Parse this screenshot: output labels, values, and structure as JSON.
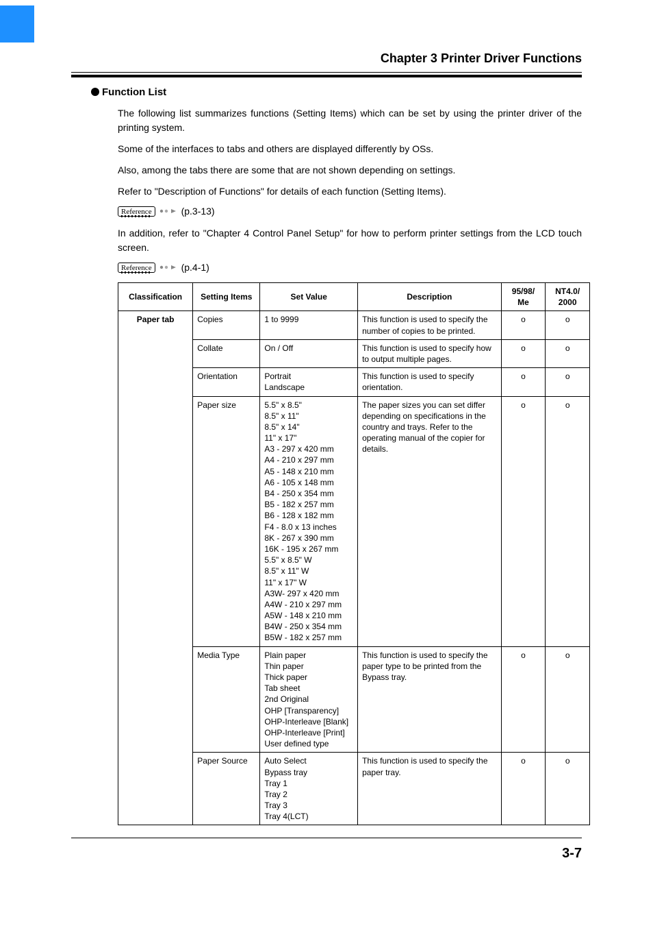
{
  "chapter_title": "Chapter 3 Printer Driver Functions",
  "section_heading": "Function List",
  "paragraphs": {
    "p1": "The following list summarizes functions (Setting Items) which can be set by using the printer driver of the printing system.",
    "p2": "Some of the interfaces to tabs and others are displayed differently by OSs.",
    "p3": "Also, among the tabs there are some that are not shown depending on settings.",
    "p4": "Refer to \"Description of Functions\" for details of each function (Setting Items).",
    "p5": "In addition, refer to \"Chapter 4 Control Panel Setup\" for how to perform printer settings from the LCD touch screen."
  },
  "references": {
    "label": "Reference",
    "r1": "(p.3-13)",
    "r2": "(p.4-1)"
  },
  "table": {
    "headers": {
      "classification": "Classification",
      "setting_items": "Setting Items",
      "set_value": "Set Value",
      "description": "Description",
      "os1": "95/98/\nMe",
      "os2": "NT4.0/\n2000"
    },
    "classification_value": "Paper tab",
    "rows": [
      {
        "item": "Copies",
        "set": "1 to 9999",
        "desc": "This function is used to specify the number of copies to be printed.",
        "os1": "o",
        "os2": "o"
      },
      {
        "item": "Collate",
        "set": "On / Off",
        "desc": "This function is used to specify how to output multiple pages.",
        "os1": "o",
        "os2": "o"
      },
      {
        "item": "Orientation",
        "set": "Portrait\nLandscape",
        "desc": "This function is used to specify orientation.",
        "os1": "o",
        "os2": "o"
      },
      {
        "item": "Paper size",
        "set": "5.5\" x 8.5\"\n8.5\" x 11\"\n8.5\" x 14\"\n11\" x 17\"\nA3 - 297 x 420 mm\nA4 - 210 x 297 mm\nA5 - 148 x 210 mm\nA6 - 105 x 148 mm\nB4 - 250 x 354 mm\nB5 - 182 x 257 mm\nB6 - 128 x 182 mm\nF4 - 8.0 x 13 inches\n8K - 267 x 390 mm\n16K - 195 x 267 mm\n5.5\" x 8.5\" W\n8.5\" x 11\" W\n11\" x 17\" W\nA3W- 297 x 420 mm\nA4W - 210 x 297 mm\nA5W - 148 x 210 mm\nB4W - 250 x 354 mm\nB5W - 182 x 257 mm",
        "desc": "The paper sizes you can set differ depending on specifications in the country and trays. Refer to the operating manual of the copier for details.",
        "os1": "o",
        "os2": "o"
      },
      {
        "item": "Media Type",
        "set": "Plain paper\nThin paper\nThick paper\nTab sheet\n2nd Original\nOHP [Transparency]\nOHP-Interleave [Blank]\nOHP-Interleave [Print]\nUser defined type",
        "desc": "This function is used to specify the paper type to be printed from the Bypass tray.",
        "os1": "o",
        "os2": "o"
      },
      {
        "item": "Paper Source",
        "set": "Auto Select\nBypass tray\nTray 1\nTray 2\nTray 3\nTray 4(LCT)",
        "desc": "This function is used to specify the paper tray.",
        "os1": "o",
        "os2": "o"
      }
    ]
  },
  "page_number": "3-7"
}
